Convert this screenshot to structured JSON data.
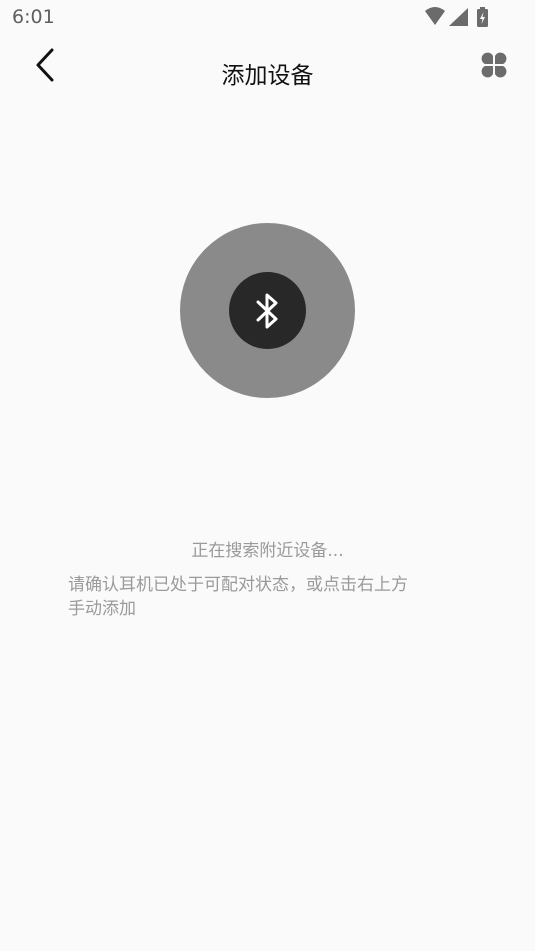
{
  "status_bar": {
    "time": "6:01",
    "icons": [
      "wifi-icon",
      "cellular-signal-icon",
      "battery-charging-icon"
    ]
  },
  "toolbar": {
    "back_icon": "chevron-left-icon",
    "title": "添加设备",
    "menu_icon": "four-petal-grid-icon"
  },
  "search_indicator": {
    "icon": "bluetooth-icon",
    "outer_color": "#8a8a8a",
    "inner_color": "#282828"
  },
  "main": {
    "status_text": "正在搜索附近设备...",
    "hint_text": "请确认耳机已处于可配对状态，或点击右上方\n手动添加"
  },
  "colors": {
    "background": "#fafafa",
    "secondary_text": "#9a9a9a",
    "title_text": "#111111"
  }
}
